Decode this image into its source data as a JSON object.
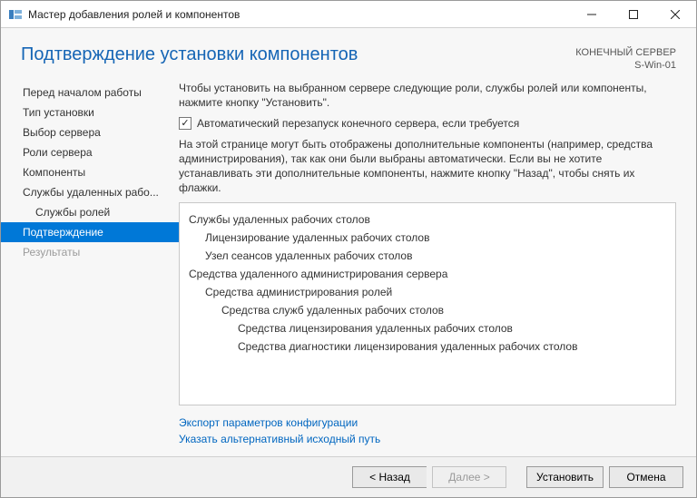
{
  "titlebar": {
    "title": "Мастер добавления ролей и компонентов"
  },
  "header": {
    "page_title": "Подтверждение установки компонентов",
    "server_label": "КОНЕЧНЫЙ СЕРВЕР",
    "server_name": "S-Win-01"
  },
  "sidebar": {
    "items": [
      {
        "label": "Перед началом работы"
      },
      {
        "label": "Тип установки"
      },
      {
        "label": "Выбор сервера"
      },
      {
        "label": "Роли сервера"
      },
      {
        "label": "Компоненты"
      },
      {
        "label": "Службы удаленных рабо..."
      },
      {
        "label": "Службы ролей",
        "indent": true
      },
      {
        "label": "Подтверждение",
        "selected": true
      },
      {
        "label": "Результаты",
        "disabled": true
      }
    ]
  },
  "main": {
    "intro": "Чтобы установить на выбранном сервере следующие роли, службы ролей или компоненты, нажмите кнопку \"Установить\".",
    "checkbox_label": "Автоматический перезапуск конечного сервера, если требуется",
    "checkbox_checked": "✓",
    "note": "На этой странице могут быть отображены дополнительные компоненты (например, средства администрирования), так как они были выбраны автоматически. Если вы не хотите устанавливать эти дополнительные компоненты, нажмите кнопку \"Назад\", чтобы снять их флажки.",
    "listing": [
      {
        "level": 0,
        "text": "Службы удаленных рабочих столов"
      },
      {
        "level": 1,
        "text": "Лицензирование удаленных рабочих столов"
      },
      {
        "level": 1,
        "text": "Узел сеансов удаленных рабочих столов"
      },
      {
        "level": 0,
        "text": "Средства удаленного администрирования сервера"
      },
      {
        "level": 1,
        "text": "Средства администрирования ролей"
      },
      {
        "level": 2,
        "text": "Средства служб удаленных рабочих столов"
      },
      {
        "level": 3,
        "text": "Средства лицензирования удаленных рабочих столов"
      },
      {
        "level": 3,
        "text": "Средства диагностики лицензирования удаленных рабочих столов"
      }
    ],
    "links": {
      "export": "Экспорт параметров конфигурации",
      "alt_source": "Указать альтернативный исходный путь"
    }
  },
  "buttons": {
    "back": "< Назад",
    "next": "Далее >",
    "install": "Установить",
    "cancel": "Отмена"
  }
}
